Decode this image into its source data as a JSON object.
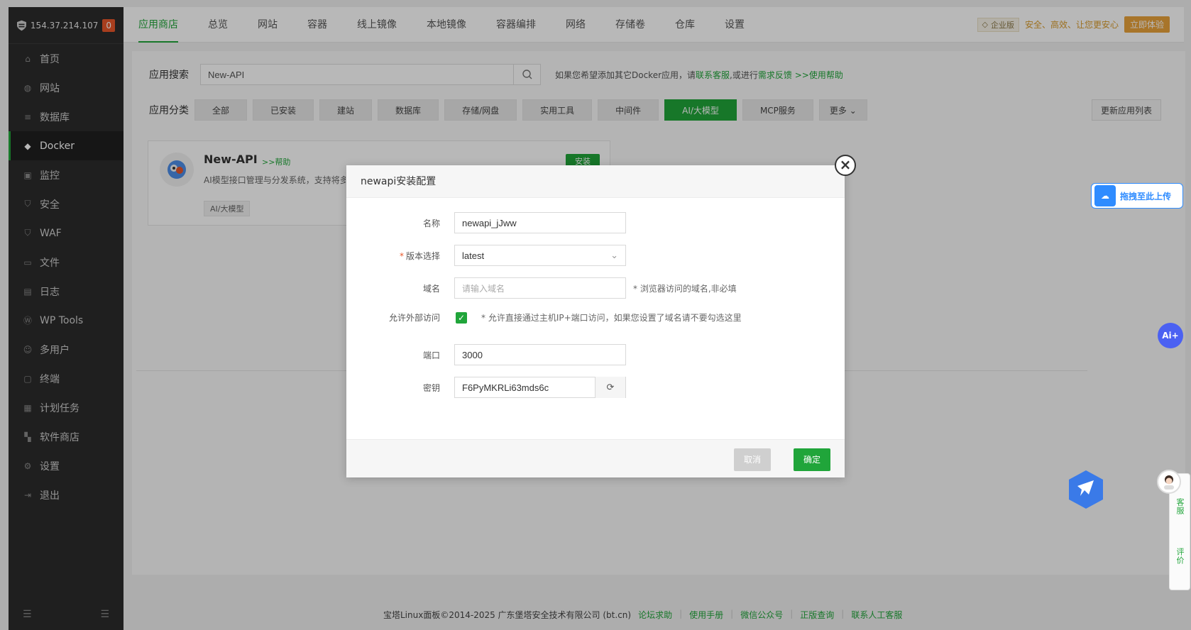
{
  "server": {
    "ip": "154.37.214.107",
    "alert_count": "0"
  },
  "sidebar": {
    "items": [
      {
        "label": "首页"
      },
      {
        "label": "网站"
      },
      {
        "label": "数据库"
      },
      {
        "label": "Docker"
      },
      {
        "label": "监控"
      },
      {
        "label": "安全"
      },
      {
        "label": "WAF"
      },
      {
        "label": "文件"
      },
      {
        "label": "日志"
      },
      {
        "label": "WP Tools"
      },
      {
        "label": "多用户"
      },
      {
        "label": "终端"
      },
      {
        "label": "计划任务"
      },
      {
        "label": "软件商店"
      },
      {
        "label": "设置"
      },
      {
        "label": "退出"
      }
    ]
  },
  "topbar": {
    "tabs": [
      "应用商店",
      "总览",
      "网站",
      "容器",
      "线上镜像",
      "本地镜像",
      "容器编排",
      "网络",
      "存储卷",
      "仓库",
      "设置"
    ],
    "enterprise_label": "企业版",
    "slogan": "安全、高效、让您更安心",
    "try_button": "立即体验"
  },
  "search": {
    "label": "应用搜索",
    "value": "New-API",
    "tip_prefix": "如果您希望添加其它Docker应用，请",
    "tip_contact": "联系客服",
    "tip_mid": ",或进行",
    "tip_feedback": "需求反馈",
    "tip_help": ">>使用帮助"
  },
  "category": {
    "label": "应用分类",
    "items": [
      "全部",
      "已安装",
      "建站",
      "数据库",
      "存储/网盘",
      "实用工具",
      "中间件",
      "AI/大模型",
      "MCP服务",
      "更多"
    ],
    "update_button": "更新应用列表"
  },
  "app": {
    "name": "New-API",
    "help": ">>帮助",
    "desc": "AI模型接口管理与分发系统，支持将多",
    "tag": "AI/大模型",
    "install": "安装"
  },
  "dialog": {
    "title": "newapi安装配置",
    "name_label": "名称",
    "name_value": "newapi_jJww",
    "version_label": "版本选择",
    "version_value": "latest",
    "domain_label": "域名",
    "domain_placeholder": "请输入域名",
    "domain_hint": "* 浏览器访问的域名,非必填",
    "external_label": "允许外部访问",
    "external_hint": "* 允许直接通过主机IP+端口访问，如果您设置了域名请不要勾选这里",
    "port_label": "端口",
    "port_value": "3000",
    "secret_label": "密钥",
    "secret_value": "F6PyMKRLi63mds6c",
    "cancel": "取消",
    "confirm": "确定"
  },
  "widgets": {
    "upload": "拖拽至此上传",
    "ai": "Ai+",
    "service": "客服",
    "review": "评价"
  },
  "footer": {
    "copyright": "宝塔Linux面板©2014-2025 广东堡塔安全技术有限公司 (bt.cn)",
    "links": [
      "论坛求助",
      "使用手册",
      "微信公众号",
      "正版查询",
      "联系人工客服"
    ]
  },
  "colors": {
    "accent": "#20a53a",
    "sidebar_bg": "#2b2b2b",
    "warning": "#e8572a"
  }
}
